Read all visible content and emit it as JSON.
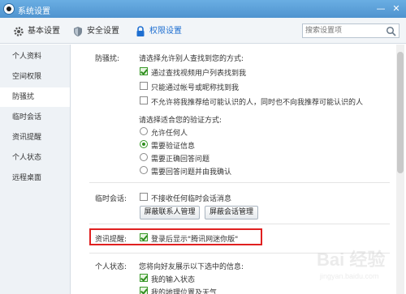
{
  "window": {
    "title": "系统设置",
    "min_label": "—",
    "close_label": "✕"
  },
  "toolbar": {
    "basic_label": "基本设置",
    "security_label": "安全设置",
    "privacy_label": "权限设置",
    "search_placeholder": "搜索设置项"
  },
  "sidebar": {
    "items": [
      {
        "label": "个人资料"
      },
      {
        "label": "空间权限"
      },
      {
        "label": "防骚扰"
      },
      {
        "label": "临时会话"
      },
      {
        "label": "资讯提醒"
      },
      {
        "label": "个人状态"
      },
      {
        "label": "远程桌面"
      }
    ]
  },
  "harassment": {
    "label": "防骚扰:",
    "find_prompt": "请选择允许别人查找到您的方式:",
    "opt1": "通过查找视频用户列表找到我",
    "opt2": "只能通过帐号或昵称找到我",
    "opt3": "不允许将我推荐给可能认识的人，同时也不向我推荐可能认识的人",
    "verify_prompt": "请选择适合您的验证方式:",
    "radio1": "允许任何人",
    "radio2": "需要验证信息",
    "radio3": "需要正确回答问题",
    "radio4": "需要回答问题并由我确认"
  },
  "temp_chat": {
    "label": "临时会话:",
    "opt": "不接收任何临时会话消息",
    "btn1": "屏蔽联系人管理",
    "btn2": "屏蔽会话管理"
  },
  "news": {
    "label": "资讯提醒:",
    "opt": "登录后显示\"腾讯网迷你版\""
  },
  "status": {
    "label": "个人状态:",
    "prompt": "您将向好友展示以下选中的信息:",
    "opt1": "我的输入状态",
    "opt2": "我的地理位置及天气"
  },
  "watermark": {
    "text": "Bai 经验",
    "sub": "jingyan.baidu.com"
  },
  "colors": {
    "accent": "#1f6fd1",
    "highlight": "#e02020",
    "check": "#2f8f1f"
  }
}
